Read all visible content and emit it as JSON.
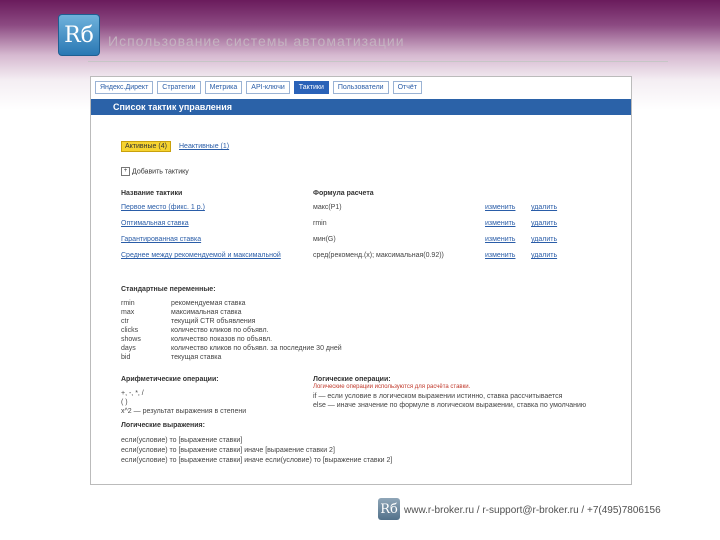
{
  "slide": {
    "logo_text": "Rб",
    "title": "Использование системы автоматизации",
    "footer": "www.r-broker.ru / r-support@r-broker.ru / +7(495)7806156"
  },
  "nav": {
    "tabs": [
      {
        "label": "Яндекс.Директ",
        "active": false
      },
      {
        "label": "Стратегии",
        "active": false
      },
      {
        "label": "Метрика",
        "active": false
      },
      {
        "label": "API-ключи",
        "active": false
      },
      {
        "label": "Тактики",
        "active": true
      },
      {
        "label": "Пользователи",
        "active": false
      },
      {
        "label": "Отчёт",
        "active": false
      }
    ]
  },
  "page": {
    "header": "Список тактик управления",
    "active_tab": "Активные (4)",
    "archive_tab": "Неактивные (1)",
    "add_label": "Добавить тактику",
    "col_name": "Название тактики",
    "col_formula": "Формула расчета",
    "rows": [
      {
        "name": "Первое место (фикс. 1 р.)",
        "formula": "макс(P1)",
        "edit": "изменить",
        "delete": "удалить"
      },
      {
        "name": "Оптимальная ставка",
        "formula": "rmin",
        "edit": "изменить",
        "delete": "удалить"
      },
      {
        "name": "Гарантированная ставка",
        "formula": "мин(G)",
        "edit": "изменить",
        "delete": "удалить"
      },
      {
        "name": "Среднее между рекомендуемой и максимальной",
        "formula": "сред(рекоменд.(x); максимальная(0.92))",
        "edit": "изменить",
        "delete": "удалить"
      }
    ]
  },
  "vars": {
    "title": "Стандартные переменные:",
    "items": [
      {
        "key": "rmin",
        "desc": "рекомендуемая ставка"
      },
      {
        "key": "max",
        "desc": "максимальная ставка"
      },
      {
        "key": "ctr",
        "desc": "текущий CTR объявления"
      },
      {
        "key": "clicks",
        "desc": "количество кликов по объявл."
      },
      {
        "key": "shows",
        "desc": "количество показов по объявл."
      },
      {
        "key": "days",
        "desc": "количество кликов по объявл. за последние 30 дней"
      },
      {
        "key": "bid",
        "desc": "текущая ставка"
      }
    ]
  },
  "ops": {
    "arith_title": "Арифметические операции:",
    "arith": [
      "+, -, *, /",
      "( )",
      "x^2 — результат выражения в степени"
    ],
    "logic_title": "Логические операции:",
    "logic_note": "Логические операции используются для расчёта ставки.",
    "logic": [
      "if — если условие в логическом выражении истинно, ставка рассчитывается",
      "else — иначе значение по формуле в логическом выражении, ставка по умолчанию"
    ]
  },
  "examples": {
    "title": "Логические выражения:",
    "items": [
      "если(условие) то [выражение ставки]",
      "если(условие) то [выражение ставки] иначе [выражение ставки 2]",
      "если(условие) то [выражение ставки] иначе если(условие) то [выражение ставки 2]"
    ]
  }
}
